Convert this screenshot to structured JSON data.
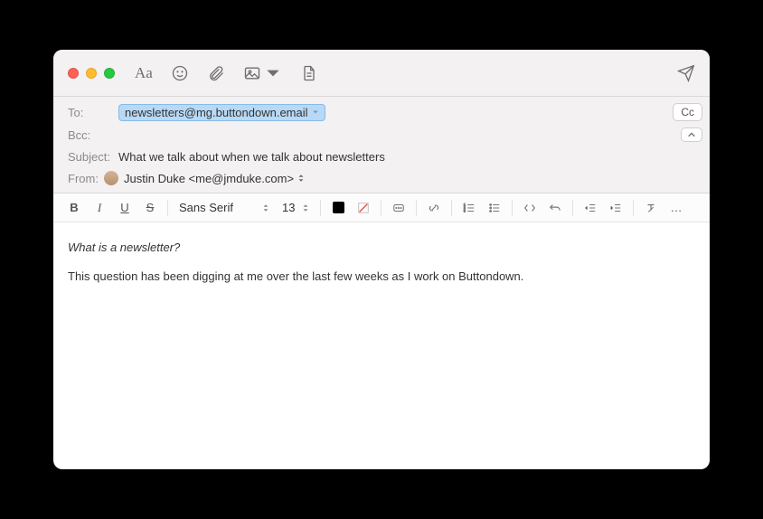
{
  "header": {
    "to_label": "To:",
    "to_value": "newsletters@mg.buttondown.email",
    "bcc_label": "Bcc:",
    "subject_label": "Subject:",
    "subject_value": "What we talk about when we talk about newsletters",
    "from_label": "From:",
    "from_value": "Justin Duke <me@jmduke.com>",
    "cc_button": "Cc"
  },
  "format": {
    "font": "Sans Serif",
    "size": "13",
    "more": "…"
  },
  "body": {
    "line1": "What is a newsletter?",
    "line2": "This question has been digging at me over the last few weeks as I work on Buttondown."
  },
  "icons": {
    "font_style": "Aa"
  }
}
